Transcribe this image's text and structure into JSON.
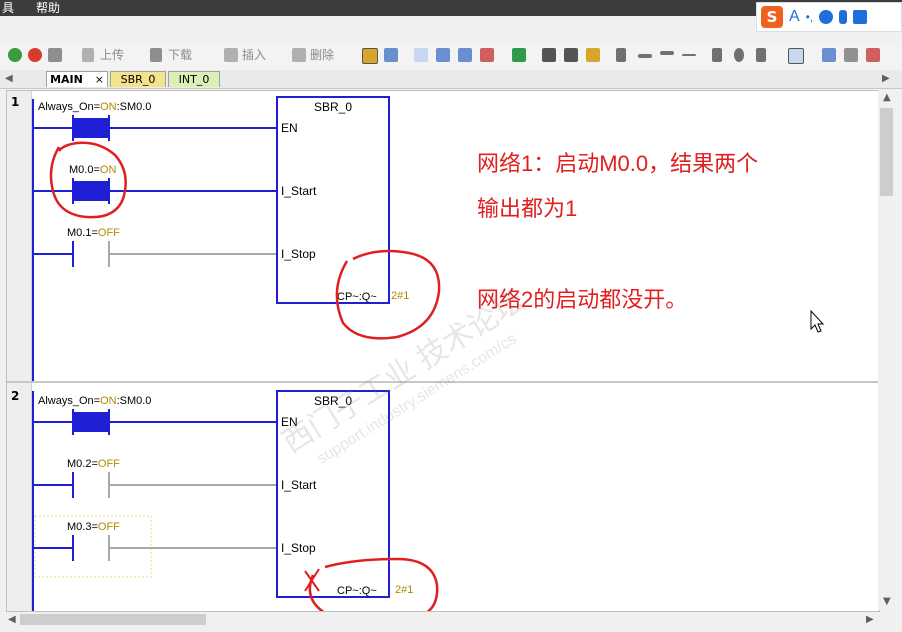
{
  "menu": {
    "item_partial": "具",
    "help": "帮助"
  },
  "ime": {
    "brand": "S",
    "mode": "A",
    "punct": "•,"
  },
  "toolbar": {
    "upload": "上传",
    "download": "下载",
    "insert": "插入",
    "delete": "删除"
  },
  "tabs": [
    {
      "label": "MAIN"
    },
    {
      "label": "SBR_0"
    },
    {
      "label": "INT_0"
    }
  ],
  "networks": [
    {
      "number": "1",
      "contacts": [
        {
          "label": "Always_On=",
          "state": "ON",
          "suffix": ":SM0.0",
          "active": true
        },
        {
          "label": "M0.0=",
          "state": "ON",
          "suffix": "",
          "active": true
        },
        {
          "label": "M0.1=",
          "state": "OFF",
          "suffix": "",
          "active": false
        }
      ],
      "box": {
        "title": "SBR_0",
        "pins": [
          "EN",
          "I_Start",
          "I_Stop"
        ],
        "output_label": "CP~:Q~",
        "output_value": "2#1"
      }
    },
    {
      "number": "2",
      "contacts": [
        {
          "label": "Always_On=",
          "state": "ON",
          "suffix": ":SM0.0",
          "active": true
        },
        {
          "label": "M0.2=",
          "state": "OFF",
          "suffix": "",
          "active": false
        },
        {
          "label": "M0.3=",
          "state": "OFF",
          "suffix": "",
          "active": false
        }
      ],
      "box": {
        "title": "SBR_0",
        "pins": [
          "EN",
          "I_Start",
          "I_Stop"
        ],
        "output_label": "CP~:Q~",
        "output_value": "2#1"
      }
    }
  ],
  "annotation": {
    "line1": "网络1：启动M0.0，结果两个",
    "line2": "输出都为1",
    "line3": "网络2的启动都没开。"
  },
  "watermark": {
    "line1": "西门子工业 技术论坛",
    "line2": "support.industry.siemens.com/cs"
  },
  "colors": {
    "wire_active": "#1f1fd6",
    "wire_inactive": "#a8a8a8",
    "state_text": "#b08a00",
    "annotation": "#e02020"
  }
}
